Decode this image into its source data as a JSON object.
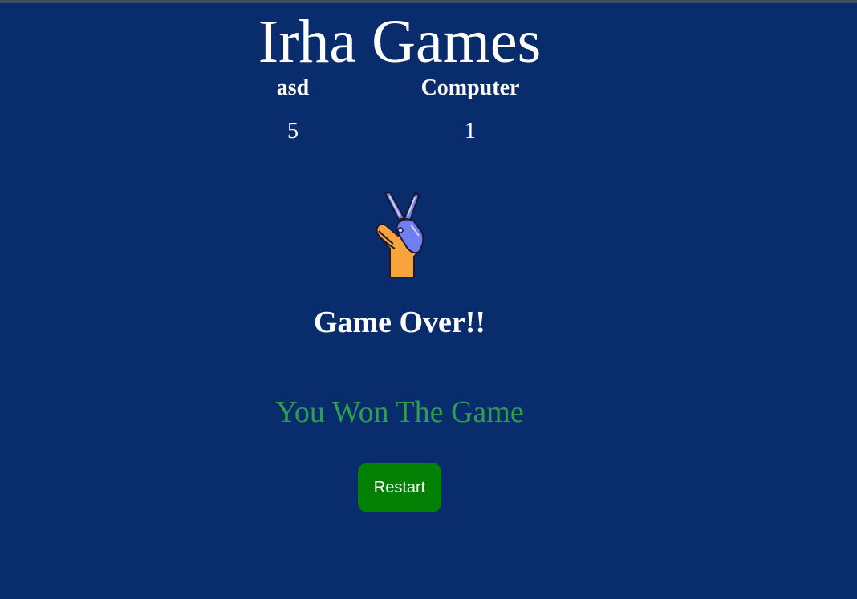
{
  "app": {
    "title": "Irha Games"
  },
  "scoreboard": {
    "player": {
      "name": "asd",
      "score": "5"
    },
    "computer": {
      "name": "Computer",
      "score": "1"
    }
  },
  "last_move": {
    "icon": "scissors-hand-icon"
  },
  "status": {
    "heading": "Game Over!!",
    "result": "You Won The Game"
  },
  "controls": {
    "restart_label": "Restart"
  },
  "colors": {
    "background": "#092c6d",
    "result_text": "#2f9d4f",
    "restart_button": "#048004"
  }
}
